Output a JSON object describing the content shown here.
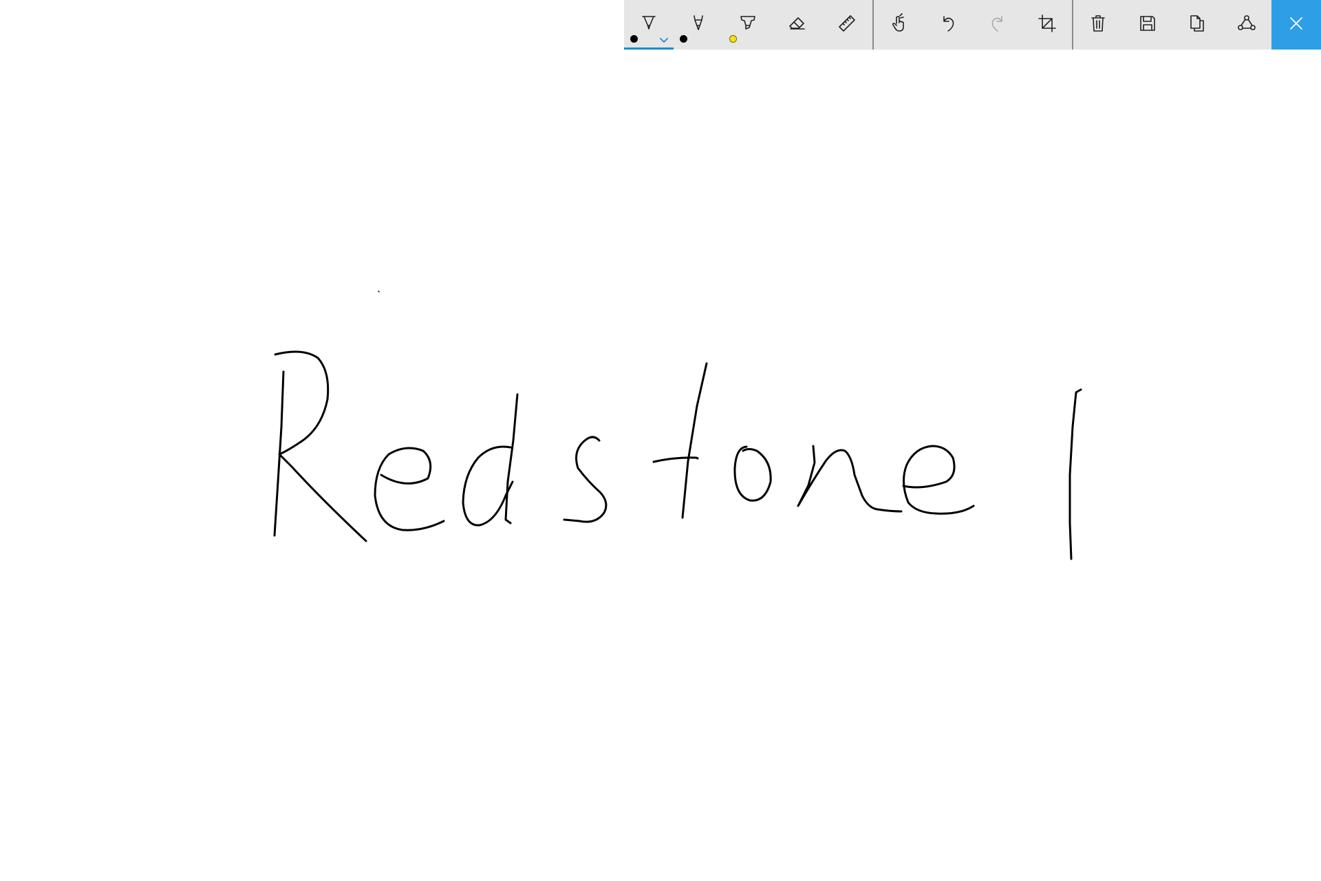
{
  "toolbar": {
    "tools": [
      {
        "name": "ballpoint-pen",
        "icon": "ballpoint-pen-icon",
        "color": "#000000",
        "selected": true
      },
      {
        "name": "pencil",
        "icon": "pencil-icon",
        "color": "#000000",
        "selected": false
      },
      {
        "name": "highlighter",
        "icon": "highlighter-icon",
        "color": "#f5e11a",
        "selected": false
      },
      {
        "name": "eraser",
        "icon": "eraser-icon"
      },
      {
        "name": "ruler",
        "icon": "ruler-icon"
      },
      {
        "name": "touch-writing",
        "icon": "touch-writing-icon"
      },
      {
        "name": "undo",
        "icon": "undo-icon"
      },
      {
        "name": "redo",
        "icon": "redo-icon",
        "disabled": true
      },
      {
        "name": "crop",
        "icon": "crop-icon"
      },
      {
        "name": "clear-all",
        "icon": "trash-icon"
      },
      {
        "name": "save",
        "icon": "save-icon"
      },
      {
        "name": "copy",
        "icon": "copy-icon"
      },
      {
        "name": "share",
        "icon": "share-icon"
      },
      {
        "name": "close",
        "icon": "close-icon"
      }
    ],
    "accent_color": "#2e9fe6",
    "background_color": "#e6e6e6"
  },
  "canvas": {
    "handwritten_text": "Redstone 1"
  }
}
